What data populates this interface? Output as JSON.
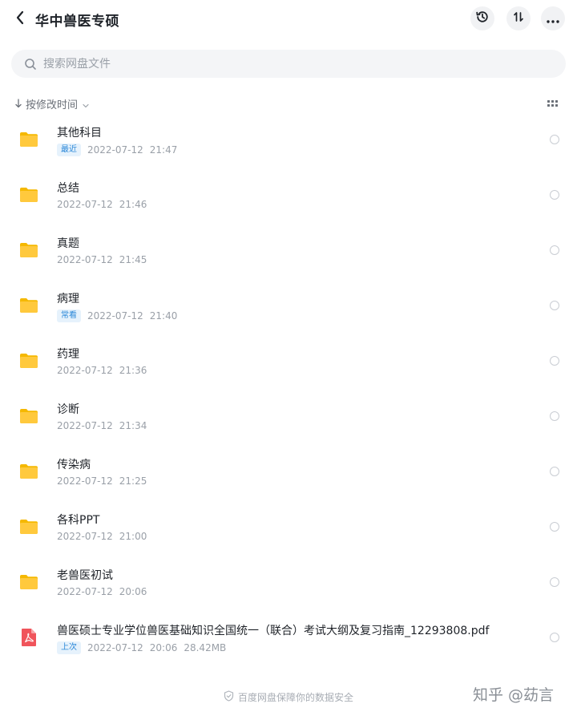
{
  "header": {
    "title": "华中兽医专硕",
    "back_icon": "chevron-left-icon",
    "history_icon": "history-clock-icon",
    "sort_icon": "sort-arrows-icon",
    "more_icon": "more-dots-icon"
  },
  "search": {
    "placeholder": "搜索网盘文件",
    "value": ""
  },
  "sort_bar": {
    "label": "按修改时间"
  },
  "files": [
    {
      "name": "其他科目",
      "type": "folder",
      "badge": "最近",
      "date": "2022-07-12",
      "time": "21:47",
      "size": ""
    },
    {
      "name": "总结",
      "type": "folder",
      "badge": "",
      "date": "2022-07-12",
      "time": "21:46",
      "size": ""
    },
    {
      "name": "真题",
      "type": "folder",
      "badge": "",
      "date": "2022-07-12",
      "time": "21:45",
      "size": ""
    },
    {
      "name": "病理",
      "type": "folder",
      "badge": "常看",
      "date": "2022-07-12",
      "time": "21:40",
      "size": ""
    },
    {
      "name": "药理",
      "type": "folder",
      "badge": "",
      "date": "2022-07-12",
      "time": "21:36",
      "size": ""
    },
    {
      "name": "诊断",
      "type": "folder",
      "badge": "",
      "date": "2022-07-12",
      "time": "21:34",
      "size": ""
    },
    {
      "name": "传染病",
      "type": "folder",
      "badge": "",
      "date": "2022-07-12",
      "time": "21:25",
      "size": ""
    },
    {
      "name": "各科PPT",
      "type": "folder",
      "badge": "",
      "date": "2022-07-12",
      "time": "21:00",
      "size": ""
    },
    {
      "name": "老兽医初试",
      "type": "folder",
      "badge": "",
      "date": "2022-07-12",
      "time": "20:06",
      "size": ""
    },
    {
      "name": "兽医硕士专业学位兽医基础知识全国统一（联合）考试大纲及复习指南_12293808.pdf",
      "type": "pdf",
      "badge": "上次",
      "date": "2022-07-12",
      "time": "20:06",
      "size": "28.42MB"
    }
  ],
  "footer": {
    "text": "百度网盘保障你的数据安全",
    "shield_icon": "shield-icon"
  },
  "watermark": "知乎 @苭言",
  "colors": {
    "folder": "#ffc93d",
    "folder_back": "#f5b800",
    "pdf": "#f0545b",
    "badge_text": "#2b88d8",
    "badge_bg": "#e6f2fc"
  }
}
